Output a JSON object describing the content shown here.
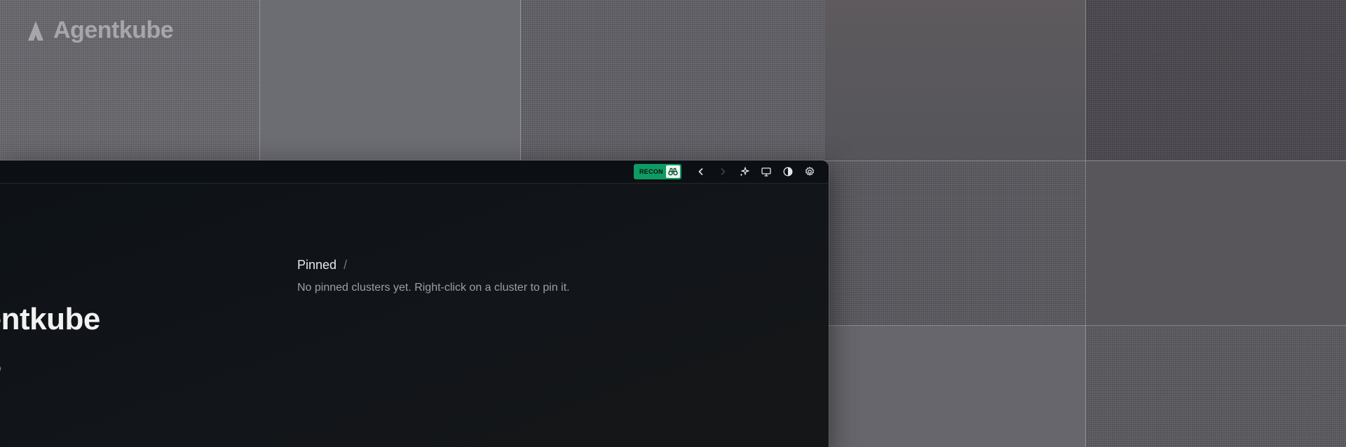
{
  "wallpaper": {
    "logo_text": "Agentkube"
  },
  "window": {
    "toolbar": {
      "recon_label": "RECON",
      "recon_icon": "binoculars-icon",
      "buttons": [
        {
          "name": "back-button",
          "icon": "chevron-left-icon"
        },
        {
          "name": "forward-button",
          "icon": "chevron-right-icon",
          "disabled": true
        },
        {
          "name": "ai-assistant-button",
          "icon": "sparkles-icon"
        },
        {
          "name": "display-button",
          "icon": "monitor-icon"
        },
        {
          "name": "theme-toggle-button",
          "icon": "contrast-icon"
        },
        {
          "name": "settings-button",
          "icon": "gear-icon"
        }
      ]
    },
    "sidebar": {
      "brand_text": "Agentkube",
      "sub_text": "o"
    },
    "pinned": {
      "title": "Pinned",
      "separator": "/",
      "empty_message": "No pinned clusters yet. Right-click on a cluster to pin it."
    }
  },
  "colors": {
    "recon_badge": "#0f9b63",
    "window_bg": "#0d1216",
    "desktop_bg": "#5f5f66"
  }
}
